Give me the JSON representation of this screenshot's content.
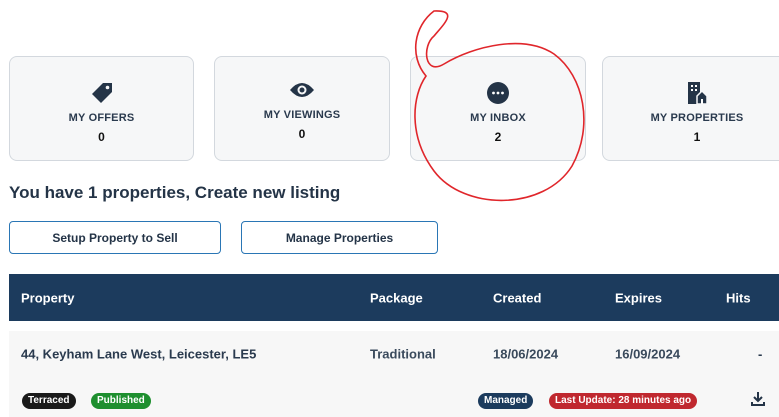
{
  "cards": [
    {
      "label": "MY OFFERS",
      "count": "0",
      "icon": "tag-icon"
    },
    {
      "label": "MY VIEWINGS",
      "count": "0",
      "icon": "eye-icon"
    },
    {
      "label": "MY INBOX",
      "count": "2",
      "icon": "chat-bubble-icon"
    },
    {
      "label": "MY PROPERTIES",
      "count": "1",
      "icon": "building-house-icon"
    }
  ],
  "headline": "You have 1 properties, Create new listing",
  "buttons": {
    "setup": "Setup Property to Sell",
    "manage": "Manage Properties"
  },
  "table": {
    "headers": [
      "Property",
      "Package",
      "Created",
      "Expires",
      "Hits"
    ],
    "rows": [
      {
        "property": "44, Keyham Lane West, Leicester, LE5",
        "package": "Traditional",
        "created": "18/06/2024",
        "expires": "16/09/2024",
        "hits": "-",
        "badges": {
          "type": "Terraced",
          "status": "Published",
          "managed": "Managed",
          "last_update": "Last Update: 28 minutes ago"
        }
      }
    ]
  },
  "colors": {
    "navy": "#1c3b5d",
    "published_green": "#1e8f2f",
    "update_red": "#c0282f",
    "annotation_red": "#e0262b"
  }
}
